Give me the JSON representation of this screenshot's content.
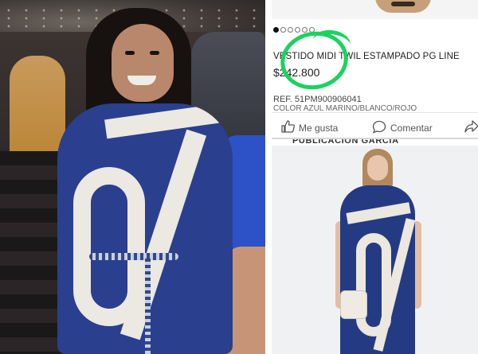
{
  "product": {
    "title": "VESTIDO MIDI TWIL ESTAMPADO PG LINE",
    "price": "$242.800",
    "ref": "REF. 51PM900906041",
    "color_line": "COLOR AZUL MARINO/BLANCO/ROJO"
  },
  "carousel": {
    "count": 6,
    "active_index": 0
  },
  "actions": {
    "like_label": "Me gusta",
    "comment_label": "Comentar"
  },
  "post_author_fragment": "PUBLICACIÓN GARCÍA",
  "colors": {
    "highlight": "#19d35e",
    "dress_navy": "#2a3f8e",
    "dress_cream": "#ece8e2"
  },
  "icons": [
    "like-icon",
    "comment-icon",
    "share-icon"
  ]
}
